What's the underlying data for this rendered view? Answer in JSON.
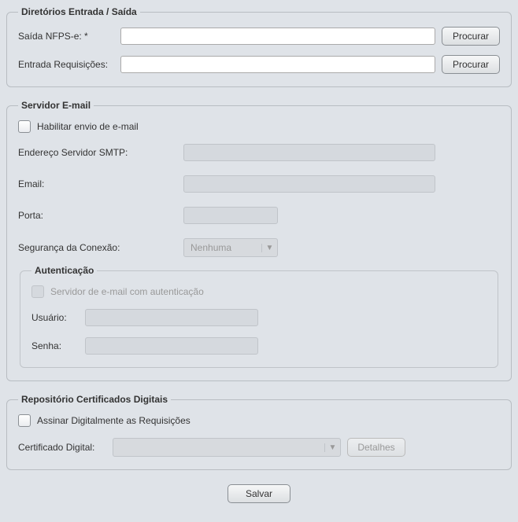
{
  "dirs": {
    "legend": "Diretórios Entrada / Saída",
    "saida_label": "Saída NFPS-e: *",
    "saida_value": "",
    "entrada_label": "Entrada Requisições:",
    "entrada_value": "",
    "browse_label": "Procurar"
  },
  "email": {
    "legend": "Servidor E-mail",
    "enable_label": "Habilitar envio de e-mail",
    "smtp_label": "Endereço Servidor SMTP:",
    "smtp_value": "",
    "email_label": "Email:",
    "email_value": "",
    "port_label": "Porta:",
    "port_value": "",
    "security_label": "Segurança da Conexão:",
    "security_value": "Nenhuma",
    "auth": {
      "legend": "Autenticação",
      "enable_label": "Servidor de e-mail com autenticação",
      "user_label": "Usuário:",
      "user_value": "",
      "pass_label": "Senha:",
      "pass_value": ""
    }
  },
  "cert": {
    "legend": "Repositório Certificados Digitais",
    "sign_label": "Assinar Digitalmente as Requisições",
    "cert_label": "Certificado Digital:",
    "cert_value": "",
    "details_label": "Detalhes"
  },
  "save_label": "Salvar"
}
